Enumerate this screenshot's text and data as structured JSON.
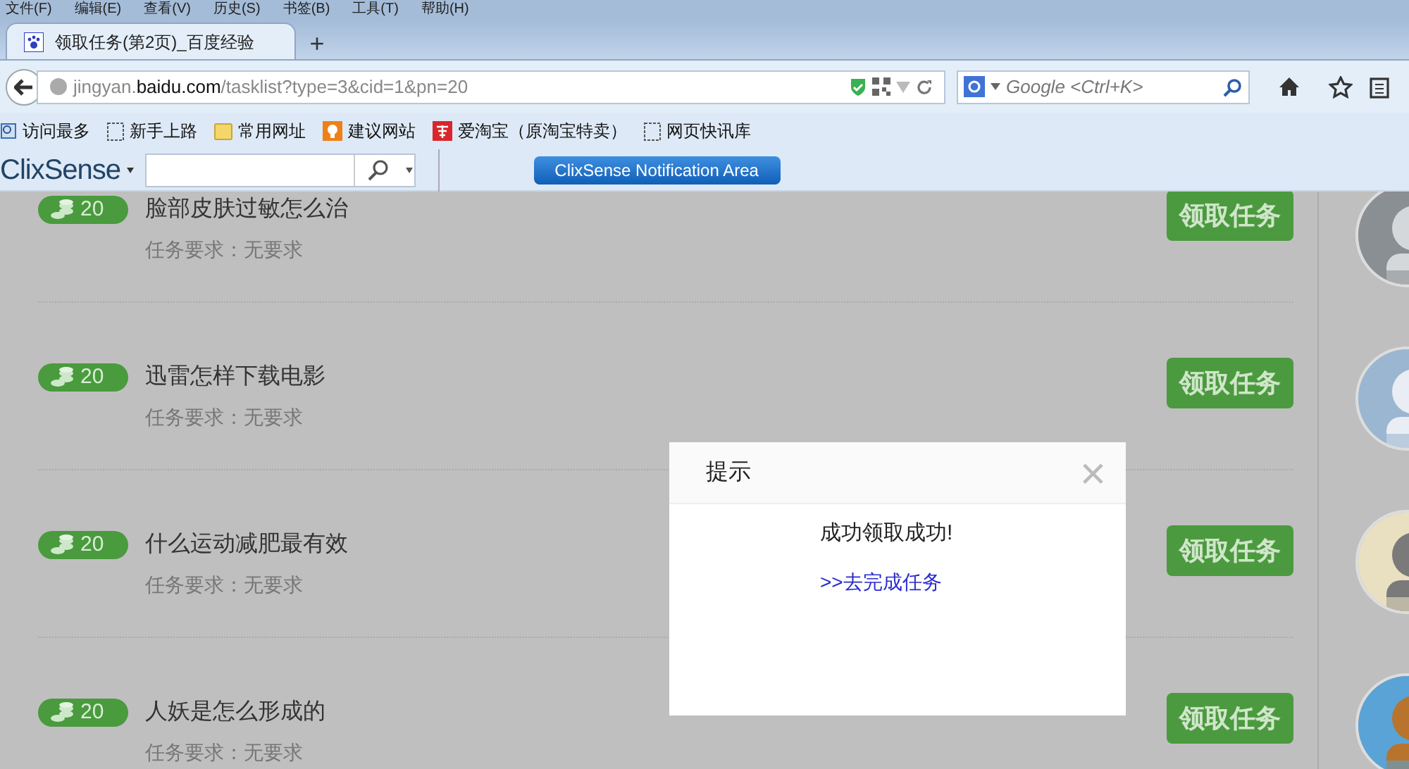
{
  "menu_bar": [
    "文件(F)",
    "编辑(E)",
    "查看(V)",
    "历史(S)",
    "书签(B)",
    "工具(T)",
    "帮助(H)"
  ],
  "tabs": [
    {
      "label": "领取任务(第2页)_百度经验",
      "selected": true
    }
  ],
  "new_tab": "+",
  "address_bar": {
    "host_prefix": "jingyan.",
    "host": "baidu.com",
    "path": "/tasklist?type=3&cid=1&pn=20"
  },
  "search_bar": {
    "placeholder": "Google <Ctrl+K>"
  },
  "bookmarks": [
    {
      "label": "访问最多",
      "kind": "search"
    },
    {
      "label": "新手上路",
      "kind": "blank"
    },
    {
      "label": "常用网址",
      "kind": "folder"
    },
    {
      "label": "建议网站",
      "kind": "bulb"
    },
    {
      "label": "爱淘宝（原淘宝特卖）",
      "kind": "taobao"
    },
    {
      "label": "网页快讯库",
      "kind": "blank"
    }
  ],
  "toolbar": {
    "logo": "ClixSense",
    "button": "ClixSense Notification Area"
  },
  "tasks": [
    {
      "points": "20",
      "title": "脸部皮肤过敏怎么治",
      "requirement": "任务要求：无要求",
      "action": "领取任务"
    },
    {
      "points": "20",
      "title": "迅雷怎样下载电影",
      "requirement": "任务要求：无要求",
      "action": "领取任务"
    },
    {
      "points": "20",
      "title": "什么运动减肥最有效",
      "requirement": "任务要求：无要求",
      "action": "领取任务"
    },
    {
      "points": "20",
      "title": "人妖是怎么形成的",
      "requirement": "任务要求：无要求",
      "action": "领取任务"
    }
  ],
  "dialog": {
    "title": "提示",
    "close": "×",
    "message": "成功领取成功!",
    "link": ">>去完成任务"
  }
}
